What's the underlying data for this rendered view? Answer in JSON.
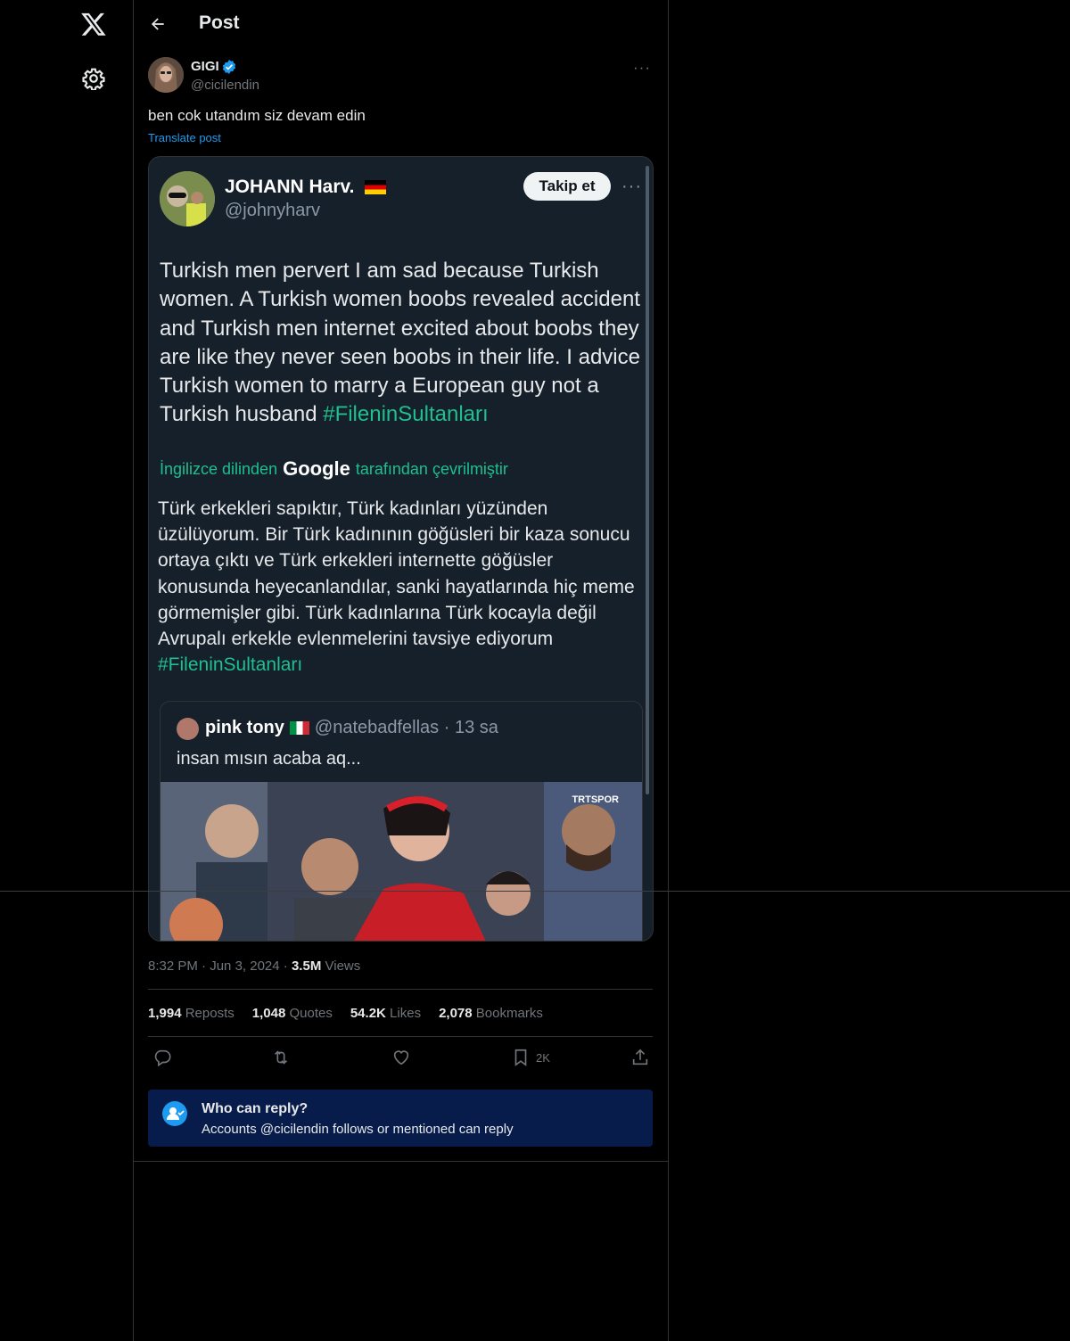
{
  "header": {
    "title": "Post"
  },
  "post": {
    "author_name": "GIGI",
    "author_handle": "@cicilendin",
    "text": "ben cok utandım siz devam edin",
    "translate_label": "Translate post",
    "time": "8:32 PM",
    "date": "Jun 3, 2024",
    "views_count": "3.5M",
    "views_label": "Views",
    "more": "···"
  },
  "quoted_image": {
    "name": "JOHANN Harv.",
    "handle": "@johnyharv",
    "follow_label": "Takip et",
    "more": "···",
    "body": "Turkish men pervert I am sad because Turkish women. A Turkish women boobs revealed accident and Turkish men internet excited about boobs they are  like they never seen boobs in their life. I advice Turkish women to marry a European guy not a Turkish husband",
    "hashtag": "#FileninSultanları",
    "translation_prefix": "İngilizce dilinden",
    "translation_brand": "Google",
    "translation_suffix": "tarafından çevrilmiştir",
    "translated_body": "Türk erkekleri sapıktır, Türk kadınları yüzünden üzülüyorum. Bir Türk kadınının göğüsleri bir kaza sonucu ortaya çıktı ve Türk erkekleri internette göğüsler konusunda heyecanlandılar, sanki hayatlarında hiç meme görmemişler gibi. Türk kadınlarına Türk kocayla değil Avrupalı erkekle evlenmelerini tavsiye ediyorum",
    "translated_hashtag": "#FileninSultanları",
    "inner_quote": {
      "name": "pink tony",
      "handle_time": "@natebadfellas · 13 sa",
      "text": "insan mısın acaba aq...",
      "watermark": "TRTSPOR"
    }
  },
  "stats": [
    {
      "count": "1,994",
      "label": "Reposts"
    },
    {
      "count": "1,048",
      "label": "Quotes"
    },
    {
      "count": "54.2K",
      "label": "Likes"
    },
    {
      "count": "2,078",
      "label": "Bookmarks"
    }
  ],
  "actions": {
    "bookmark_count": "2K"
  },
  "who_can_reply": {
    "title": "Who can reply?",
    "subtitle": "Accounts @cicilendin follows or mentioned can reply"
  },
  "colors": {
    "background": "#000000",
    "accent": "#1d9bf0",
    "hashtag": "#1fbf8f",
    "reply_banner": "#071c4a"
  }
}
